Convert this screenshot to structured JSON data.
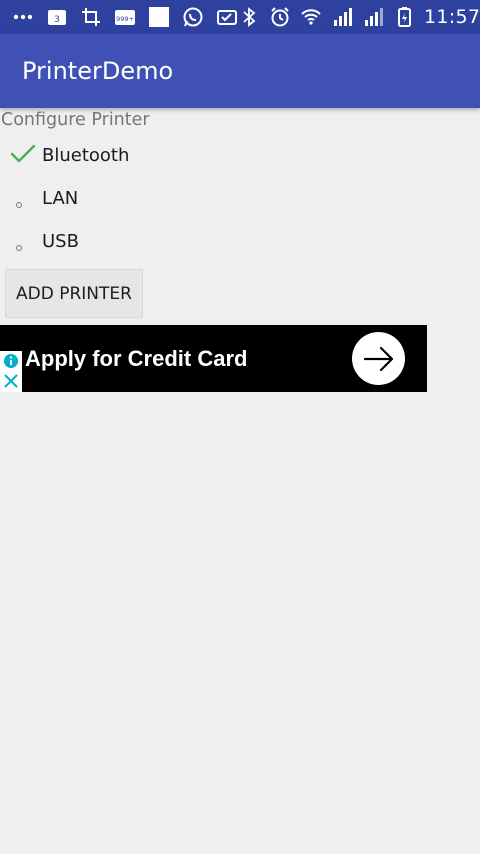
{
  "status_bar": {
    "time": "11:57",
    "notif_badge": "3",
    "msg_badge": "999+"
  },
  "app_bar": {
    "title": "PrinterDemo"
  },
  "configure": {
    "label": "Configure Printer",
    "options": [
      {
        "label": "Bluetooth",
        "selected": true
      },
      {
        "label": "LAN",
        "selected": false
      },
      {
        "label": "USB",
        "selected": false
      }
    ],
    "add_button": "ADD PRINTER"
  },
  "ad": {
    "text": "Apply for Credit Card"
  },
  "colors": {
    "status_bar": "#2f419e",
    "app_bar": "#3f51b5",
    "check": "#4caf50",
    "background": "#efefef"
  }
}
